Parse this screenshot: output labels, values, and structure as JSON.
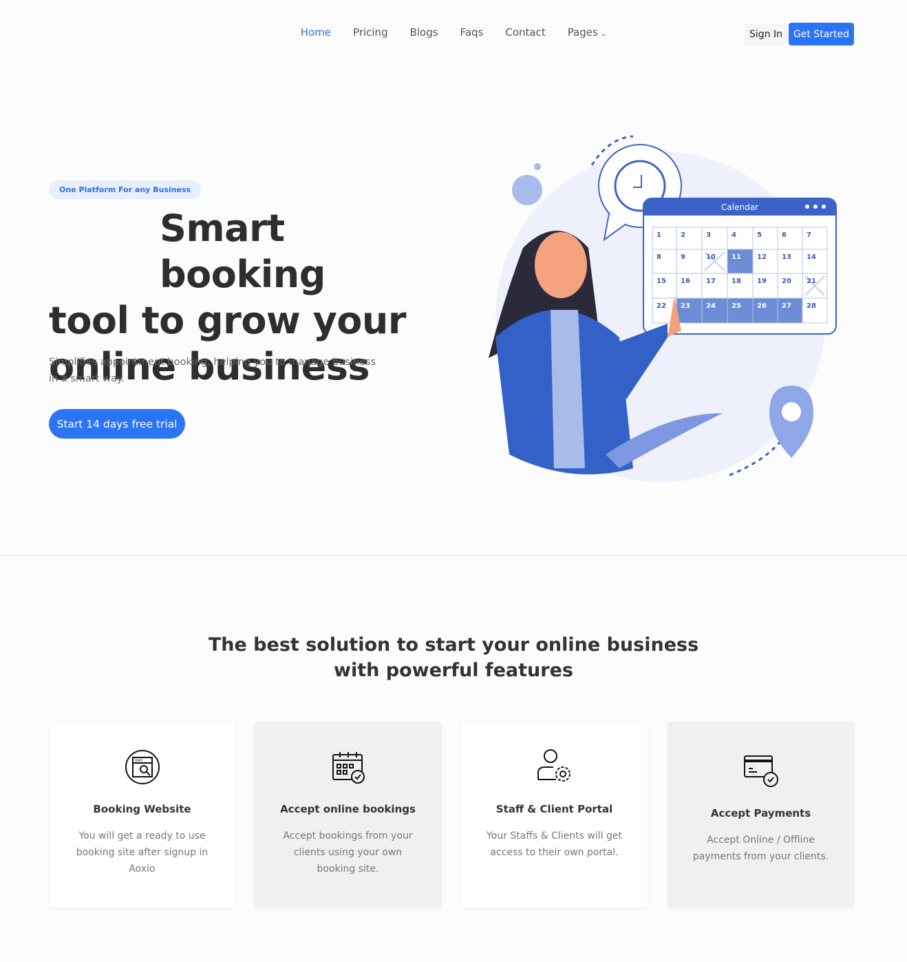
{
  "nav": {
    "links": [
      "Home",
      "Pricing",
      "Blogs",
      "Faqs",
      "Contact",
      "Pages"
    ],
    "active": "Home",
    "sign_in": "Sign In",
    "get_started": "Get Started"
  },
  "hero": {
    "badge": "One Platform For any Business",
    "title_line1": "Smart booking",
    "title_line2": "tool to grow your",
    "title_line3": "online business",
    "subtitle": "Simplifies appointment booking, helping you to manage business in a smart way.",
    "cta": "Start 14 days free trial"
  },
  "illustration": {
    "calendar_title": "Calendar",
    "days": [
      1,
      2,
      3,
      4,
      5,
      6,
      7,
      8,
      9,
      10,
      11,
      12,
      13,
      14,
      15,
      16,
      17,
      18,
      19,
      20,
      21,
      22,
      23,
      24,
      25,
      26,
      27,
      28
    ],
    "highlighted": [
      11,
      23,
      24,
      25,
      26,
      27
    ],
    "crossed": [
      10,
      21
    ]
  },
  "features": {
    "title_line1": "The best solution to start your online business",
    "title_line2": "with powerful features",
    "cards": [
      {
        "icon": "browser-search-icon",
        "title": "Booking Website",
        "text": "You will get a ready to use booking site after signup in Aoxio"
      },
      {
        "icon": "calendar-check-icon",
        "title": "Accept online bookings",
        "text": "Accept bookings from your clients using your own booking site."
      },
      {
        "icon": "user-gear-icon",
        "title": "Staff & Client Portal",
        "text": "Your Staffs & Clients will get access to their own portal."
      },
      {
        "icon": "card-check-icon",
        "title": "Accept Payments",
        "text": "Accept Online / Offline payments from your clients."
      }
    ]
  },
  "colors": {
    "accent": "#2a74f5",
    "illustration_blue": "#3b63c9"
  }
}
